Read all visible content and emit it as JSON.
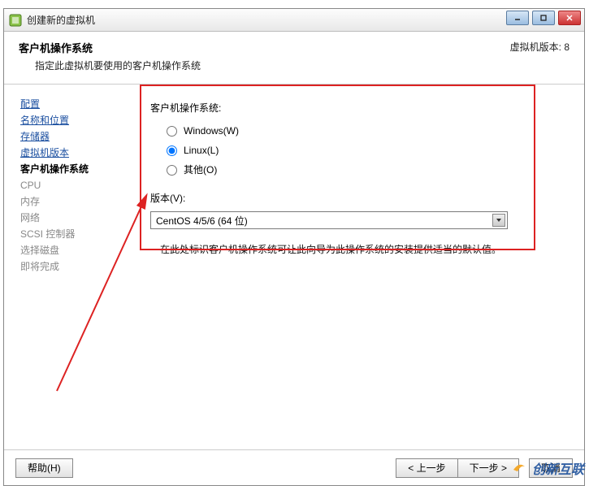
{
  "window": {
    "title": "创建新的虚拟机"
  },
  "header": {
    "heading": "客户机操作系统",
    "subheading": "指定此虚拟机要使用的客户机操作系统",
    "vm_version_label": "虚拟机版本: 8"
  },
  "sidebar": {
    "items": [
      {
        "label": "配置",
        "kind": "link"
      },
      {
        "label": "名称和位置",
        "kind": "link"
      },
      {
        "label": "存储器",
        "kind": "link"
      },
      {
        "label": "虚拟机版本",
        "kind": "link"
      },
      {
        "label": "客户机操作系统",
        "kind": "current"
      },
      {
        "label": "CPU",
        "kind": "future"
      },
      {
        "label": "内存",
        "kind": "future"
      },
      {
        "label": "网络",
        "kind": "future"
      },
      {
        "label": "SCSI 控制器",
        "kind": "future"
      },
      {
        "label": "选择磁盘",
        "kind": "future"
      },
      {
        "label": "即将完成",
        "kind": "future"
      }
    ]
  },
  "main": {
    "os_group_label": "客户机操作系统:",
    "radios": {
      "windows": "Windows(W)",
      "linux": "Linux(L)",
      "other": "其他(O)",
      "selected": "linux"
    },
    "version_label": "版本(V):",
    "version_selected": "CentOS 4/5/6 (64 位)",
    "hint": "在此处标识客户机操作系统可让此向导为此操作系统的安装提供适当的默认值。"
  },
  "footer": {
    "help": "帮助(H)",
    "back": "< 上一步",
    "next": "下一步 >",
    "cancel": "取消"
  },
  "watermark": {
    "text": "创新互联"
  }
}
